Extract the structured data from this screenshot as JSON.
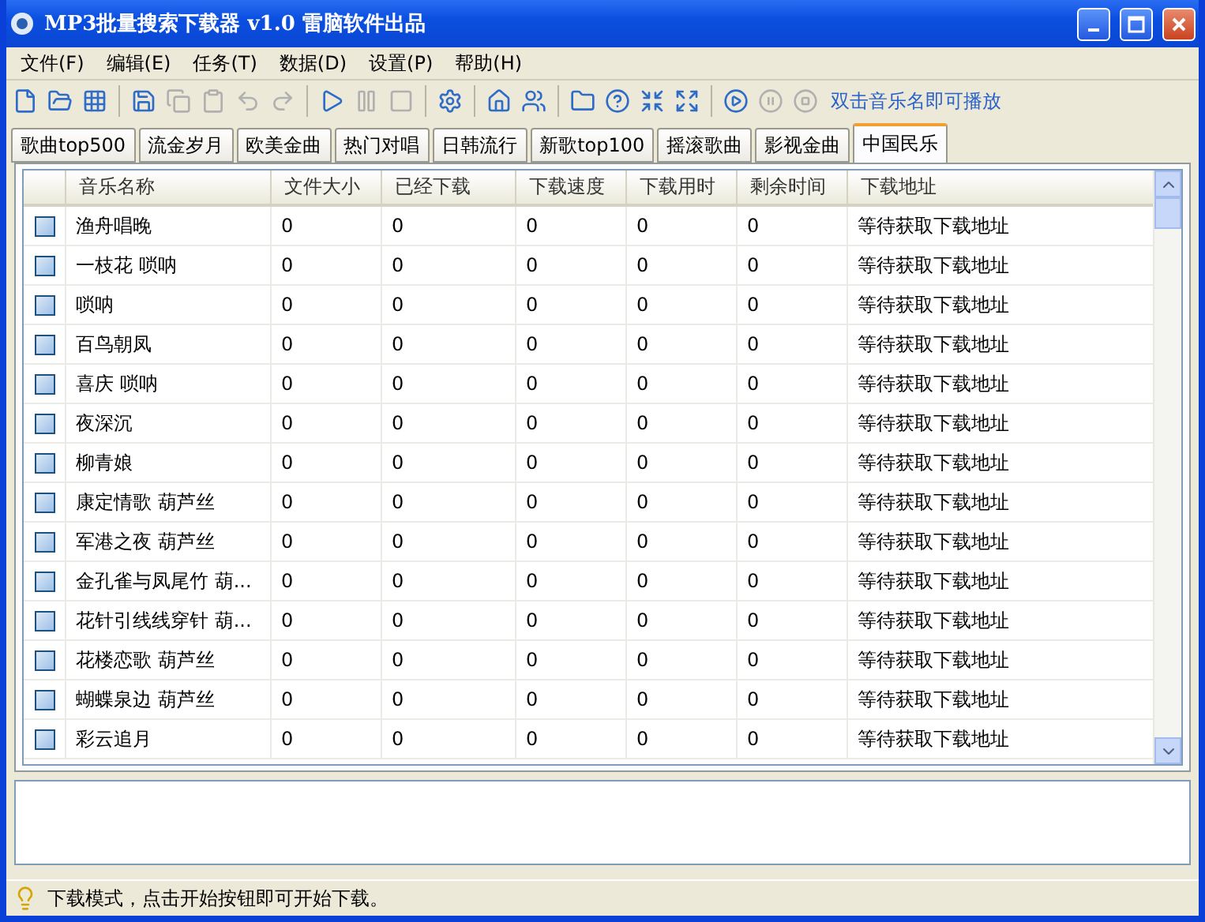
{
  "window": {
    "title": "MP3批量搜索下载器 v1.0 雷脑软件出品"
  },
  "menu": [
    "文件(F)",
    "编辑(E)",
    "任务(T)",
    "数据(D)",
    "设置(P)",
    "帮助(H)"
  ],
  "toolbar": {
    "groups": [
      [
        {
          "disabled": false
        },
        {
          "disabled": false
        },
        {
          "disabled": false
        }
      ],
      [
        {
          "disabled": false
        },
        {
          "disabled": true
        },
        {
          "disabled": true
        },
        {
          "disabled": true
        },
        {
          "disabled": true
        }
      ],
      [
        {
          "disabled": false
        },
        {
          "disabled": true
        },
        {
          "disabled": true
        }
      ],
      [
        {
          "disabled": false
        }
      ],
      [
        {
          "disabled": false
        },
        {
          "disabled": false
        }
      ],
      [
        {
          "disabled": false
        },
        {
          "disabled": false
        },
        {
          "disabled": false
        },
        {
          "disabled": false
        }
      ],
      [
        {
          "disabled": false
        },
        {
          "disabled": true
        },
        {
          "disabled": true
        }
      ]
    ],
    "hint": "双击音乐名即可播放"
  },
  "tabs": [
    {
      "label": "歌曲top500",
      "selected": false
    },
    {
      "label": "流金岁月",
      "selected": false
    },
    {
      "label": "欧美金曲",
      "selected": false
    },
    {
      "label": "热门对唱",
      "selected": false
    },
    {
      "label": "日韩流行",
      "selected": false
    },
    {
      "label": "新歌top100",
      "selected": false
    },
    {
      "label": "摇滚歌曲",
      "selected": false
    },
    {
      "label": "影视金曲",
      "selected": false
    },
    {
      "label": "中国民乐",
      "selected": true
    }
  ],
  "table": {
    "columns": [
      "音乐名称",
      "文件大小",
      "已经下载",
      "下载速度",
      "下载用时",
      "剩余时间",
      "下载地址"
    ],
    "rows": [
      {
        "checked": false,
        "cells": [
          "渔舟唱晚",
          "0",
          "0",
          "0",
          "0",
          "0",
          "等待获取下载地址"
        ]
      },
      {
        "checked": false,
        "cells": [
          "一枝花 唢呐",
          "0",
          "0",
          "0",
          "0",
          "0",
          "等待获取下载地址"
        ]
      },
      {
        "checked": false,
        "cells": [
          "唢呐",
          "0",
          "0",
          "0",
          "0",
          "0",
          "等待获取下载地址"
        ]
      },
      {
        "checked": false,
        "cells": [
          "百鸟朝凤",
          "0",
          "0",
          "0",
          "0",
          "0",
          "等待获取下载地址"
        ]
      },
      {
        "checked": false,
        "cells": [
          "喜庆 唢呐",
          "0",
          "0",
          "0",
          "0",
          "0",
          "等待获取下载地址"
        ]
      },
      {
        "checked": false,
        "cells": [
          "夜深沉",
          "0",
          "0",
          "0",
          "0",
          "0",
          "等待获取下载地址"
        ]
      },
      {
        "checked": false,
        "cells": [
          "柳青娘",
          "0",
          "0",
          "0",
          "0",
          "0",
          "等待获取下载地址"
        ]
      },
      {
        "checked": false,
        "cells": [
          "康定情歌 葫芦丝",
          "0",
          "0",
          "0",
          "0",
          "0",
          "等待获取下载地址"
        ]
      },
      {
        "checked": false,
        "cells": [
          "军港之夜 葫芦丝",
          "0",
          "0",
          "0",
          "0",
          "0",
          "等待获取下载地址"
        ]
      },
      {
        "checked": false,
        "cells": [
          "金孔雀与凤尾竹 葫...",
          "0",
          "0",
          "0",
          "0",
          "0",
          "等待获取下载地址"
        ]
      },
      {
        "checked": false,
        "cells": [
          "花针引线线穿针 葫...",
          "0",
          "0",
          "0",
          "0",
          "0",
          "等待获取下载地址"
        ]
      },
      {
        "checked": false,
        "cells": [
          "花楼恋歌 葫芦丝",
          "0",
          "0",
          "0",
          "0",
          "0",
          "等待获取下载地址"
        ]
      },
      {
        "checked": false,
        "cells": [
          "蝴蝶泉边 葫芦丝",
          "0",
          "0",
          "0",
          "0",
          "0",
          "等待获取下载地址"
        ]
      },
      {
        "checked": false,
        "cells": [
          "彩云追月",
          "0",
          "0",
          "0",
          "0",
          "0",
          "等待获取下载地址"
        ]
      }
    ]
  },
  "status_bar": {
    "text": "下载模式，点击开始按钮即可开始下载。"
  }
}
